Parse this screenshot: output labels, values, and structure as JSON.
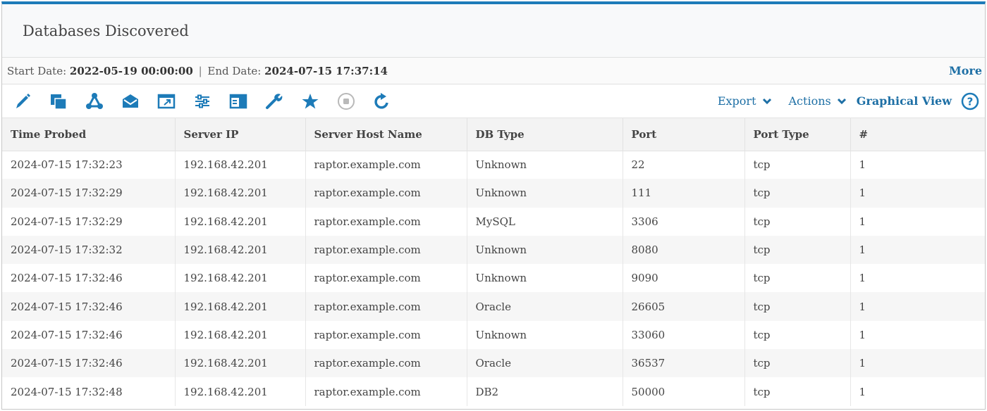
{
  "page": {
    "title": "Databases Discovered"
  },
  "dates": {
    "start_label": "Start Date:",
    "start_value": "2022-05-19 00:00:00",
    "separator": "|",
    "end_label": "End Date:",
    "end_value": "2024-07-15 17:37:14",
    "more_label": "More"
  },
  "toolbar": {
    "icons": [
      "pencil-icon",
      "copy-icon",
      "network-icon",
      "mail-icon",
      "external-window-icon",
      "sliders-icon",
      "layout-icon",
      "wrench-icon",
      "star-icon",
      "stop-icon",
      "refresh-icon"
    ],
    "export_label": "Export",
    "actions_label": "Actions",
    "graphical_view_label": "Graphical View",
    "help_icon": "help-icon",
    "accent_color": "#1d7bb8"
  },
  "table": {
    "headers": [
      "Time Probed",
      "Server IP",
      "Server Host Name",
      "DB Type",
      "Port",
      "Port Type",
      "#"
    ],
    "rows": [
      [
        "2024-07-15 17:32:23",
        "192.168.42.201",
        "raptor.example.com",
        "Unknown",
        "22",
        "tcp",
        "1"
      ],
      [
        "2024-07-15 17:32:29",
        "192.168.42.201",
        "raptor.example.com",
        "Unknown",
        "111",
        "tcp",
        "1"
      ],
      [
        "2024-07-15 17:32:29",
        "192.168.42.201",
        "raptor.example.com",
        "MySQL",
        "3306",
        "tcp",
        "1"
      ],
      [
        "2024-07-15 17:32:32",
        "192.168.42.201",
        "raptor.example.com",
        "Unknown",
        "8080",
        "tcp",
        "1"
      ],
      [
        "2024-07-15 17:32:46",
        "192.168.42.201",
        "raptor.example.com",
        "Unknown",
        "9090",
        "tcp",
        "1"
      ],
      [
        "2024-07-15 17:32:46",
        "192.168.42.201",
        "raptor.example.com",
        "Oracle",
        "26605",
        "tcp",
        "1"
      ],
      [
        "2024-07-15 17:32:46",
        "192.168.42.201",
        "raptor.example.com",
        "Unknown",
        "33060",
        "tcp",
        "1"
      ],
      [
        "2024-07-15 17:32:46",
        "192.168.42.201",
        "raptor.example.com",
        "Oracle",
        "36537",
        "tcp",
        "1"
      ],
      [
        "2024-07-15 17:32:48",
        "192.168.42.201",
        "raptor.example.com",
        "DB2",
        "50000",
        "tcp",
        "1"
      ]
    ]
  }
}
